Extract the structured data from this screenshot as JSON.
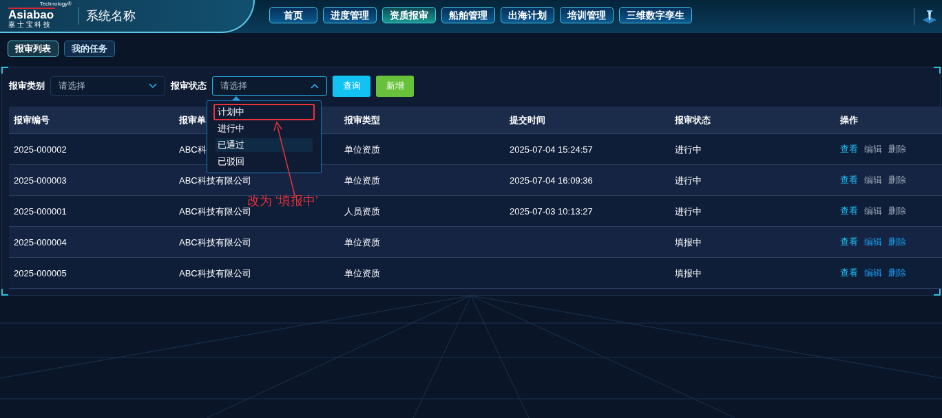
{
  "header": {
    "logo": {
      "brand": "Asiabao",
      "tagline": "Technology®",
      "subtitle": "嘉 士 宝 科 技"
    },
    "system_name": "系统名称",
    "nav": [
      {
        "label": "首页",
        "selected": false
      },
      {
        "label": "进度管理",
        "selected": false
      },
      {
        "label": "资质报审",
        "selected": true
      },
      {
        "label": "船舶管理",
        "selected": false
      },
      {
        "label": "出海计划",
        "selected": false
      },
      {
        "label": "培训管理",
        "selected": false
      },
      {
        "label": "三维数字孪生",
        "selected": false
      }
    ]
  },
  "subtabs": [
    {
      "label": "报审列表",
      "selected": true
    },
    {
      "label": "我的任务",
      "selected": false
    }
  ],
  "filters": [
    {
      "label": "报审类别",
      "placeholder": "请选择",
      "expanded": false
    },
    {
      "label": "报审状态",
      "placeholder": "请选择",
      "expanded": true
    }
  ],
  "buttons": [
    {
      "label": "查询",
      "kind": "primary"
    },
    {
      "label": "新增",
      "kind": "success"
    }
  ],
  "dropdown": {
    "options": [
      {
        "label": "计划中",
        "hovered": false,
        "annotated": true
      },
      {
        "label": "进行中",
        "hovered": false,
        "annotated": false
      },
      {
        "label": "已通过",
        "hovered": true,
        "annotated": false
      },
      {
        "label": "已驳回",
        "hovered": false,
        "annotated": false
      }
    ]
  },
  "table": {
    "columns": [
      "报审编号",
      "报审单",
      "报审类型",
      "提交时间",
      "报审状态",
      "操作"
    ],
    "rows": [
      {
        "cells": [
          "2025-000002",
          "ABC科",
          "单位资质",
          "2025-07-04 15:24:57",
          "进行中"
        ],
        "actions": [
          {
            "label": "查看",
            "disabled": false
          },
          {
            "label": "编辑",
            "disabled": true
          },
          {
            "label": "删除",
            "disabled": true
          }
        ]
      },
      {
        "cells": [
          "2025-000003",
          "ABC科技有限公司",
          "单位资质",
          "2025-07-04 16:09:36",
          "进行中"
        ],
        "actions": [
          {
            "label": "查看",
            "disabled": false
          },
          {
            "label": "编辑",
            "disabled": true
          },
          {
            "label": "删除",
            "disabled": true
          }
        ]
      },
      {
        "cells": [
          "2025-000001",
          "ABC科技有限公司",
          "人员资质",
          "2025-07-03 10:13:27",
          "进行中"
        ],
        "actions": [
          {
            "label": "查看",
            "disabled": false
          },
          {
            "label": "编辑",
            "disabled": true
          },
          {
            "label": "删除",
            "disabled": true
          }
        ]
      },
      {
        "cells": [
          "2025-000004",
          "ABC科技有限公司",
          "单位资质",
          "",
          "填报中"
        ],
        "actions": [
          {
            "label": "查看",
            "disabled": false
          },
          {
            "label": "编辑",
            "disabled": false
          },
          {
            "label": "删除",
            "disabled": false
          }
        ]
      },
      {
        "cells": [
          "2025-000005",
          "ABC科技有限公司",
          "单位资质",
          "",
          "填报中"
        ],
        "actions": [
          {
            "label": "查看",
            "disabled": false
          },
          {
            "label": "编辑",
            "disabled": false
          },
          {
            "label": "删除",
            "disabled": false
          }
        ]
      }
    ]
  },
  "annotation": {
    "text": "改为 ‘填报中’"
  }
}
